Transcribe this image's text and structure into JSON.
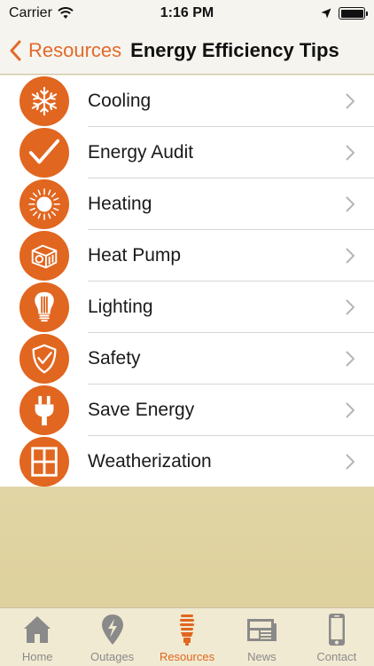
{
  "status": {
    "carrier": "Carrier",
    "time": "1:16 PM"
  },
  "nav": {
    "back_label": "Resources",
    "title": "Energy Efficiency Tips"
  },
  "colors": {
    "accent": "#e1661f",
    "icon_bg": "#e1661f",
    "tab_inactive": "#8a8a8a"
  },
  "items": [
    {
      "label": "Cooling",
      "icon": "snowflake-icon"
    },
    {
      "label": "Energy Audit",
      "icon": "checkmark-icon"
    },
    {
      "label": "Heating",
      "icon": "sun-icon"
    },
    {
      "label": "Heat Pump",
      "icon": "heat-pump-icon"
    },
    {
      "label": "Lighting",
      "icon": "lightbulb-icon"
    },
    {
      "label": "Safety",
      "icon": "shield-check-icon"
    },
    {
      "label": "Save Energy",
      "icon": "plug-icon"
    },
    {
      "label": "Weatherization",
      "icon": "window-icon"
    }
  ],
  "tabs": [
    {
      "label": "Home",
      "icon": "house-icon"
    },
    {
      "label": "Outages",
      "icon": "map-pin-bolt-icon"
    },
    {
      "label": "Resources",
      "icon": "cfl-bulb-icon",
      "active": true
    },
    {
      "label": "News",
      "icon": "newspaper-icon"
    },
    {
      "label": "Contact",
      "icon": "phone-icon"
    }
  ]
}
